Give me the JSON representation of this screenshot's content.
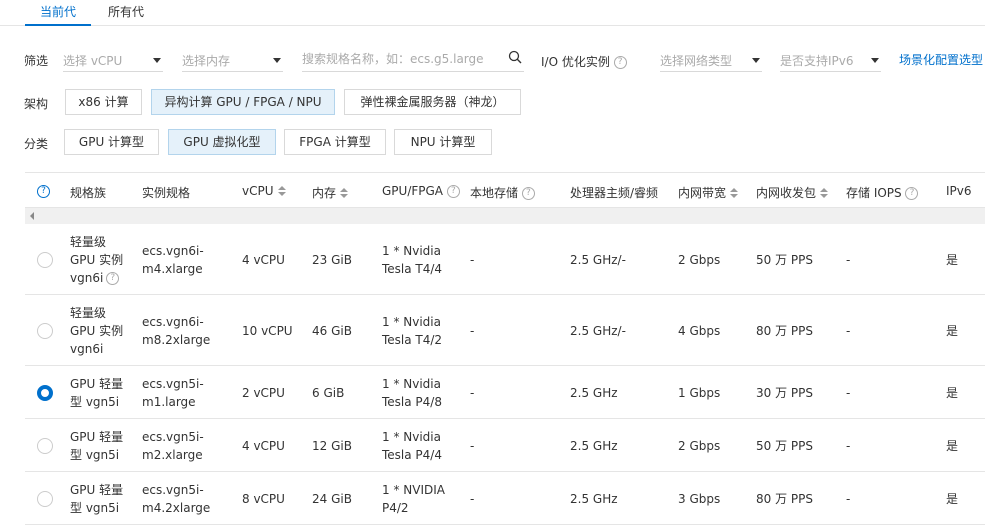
{
  "tabs": [
    {
      "label": "当前代",
      "active": true
    },
    {
      "label": "所有代",
      "active": false
    }
  ],
  "filter": {
    "label": "筛选",
    "vcpu_placeholder": "选择 vCPU",
    "memory_placeholder": "选择内存",
    "search_placeholder": "搜索规格名称，如：ecs.g5.large",
    "io_label": "I/O 优化实例",
    "network_placeholder": "选择网络类型",
    "ipv6_placeholder": "是否支持IPv6",
    "scene_link": "场景化配置选型"
  },
  "arch": {
    "label": "架构",
    "options": [
      "x86 计算",
      "异构计算 GPU / FPGA / NPU",
      "弹性裸金属服务器（神龙）"
    ],
    "selected_index": 1
  },
  "category": {
    "label": "分类",
    "options": [
      "GPU 计算型",
      "GPU 虚拟化型",
      "FPGA 计算型",
      "NPU 计算型"
    ],
    "selected_index": 1
  },
  "table": {
    "columns": [
      "规格族",
      "实例规格",
      "vCPU",
      "内存",
      "GPU/FPGA",
      "本地存储",
      "处理器主频/睿频",
      "内网带宽",
      "内网收发包",
      "存储 IOPS",
      "IPv6"
    ],
    "rows": [
      {
        "family": [
          "轻量级",
          "GPU 实例",
          "vgn6i"
        ],
        "spec": [
          "ecs.vgn6i-",
          "m4.xlarge"
        ],
        "vcpu": "4 vCPU",
        "mem": "23 GiB",
        "gpu": [
          "1 * Nvidia",
          "Tesla T4/4"
        ],
        "disk": "-",
        "freq": "2.5 GHz/-",
        "bw": "2 Gbps",
        "pps": "50 万 PPS",
        "iops": "-",
        "ipv6": "是",
        "selected": false
      },
      {
        "family": [
          "轻量级",
          "GPU 实例",
          "vgn6i"
        ],
        "spec": [
          "ecs.vgn6i-",
          "m8.2xlarge"
        ],
        "vcpu": "10 vCPU",
        "mem": "46 GiB",
        "gpu": [
          "1 * Nvidia",
          "Tesla T4/2"
        ],
        "disk": "-",
        "freq": "2.5 GHz/-",
        "bw": "4 Gbps",
        "pps": "80 万 PPS",
        "iops": "-",
        "ipv6": "是",
        "selected": false
      },
      {
        "family": [
          "GPU 轻量",
          "型 vgn5i"
        ],
        "spec": [
          "ecs.vgn5i-",
          "m1.large"
        ],
        "vcpu": "2 vCPU",
        "mem": "6 GiB",
        "gpu": [
          "1 * Nvidia",
          "Tesla P4/8"
        ],
        "disk": "-",
        "freq": "2.5 GHz",
        "bw": "1 Gbps",
        "pps": "30 万 PPS",
        "iops": "-",
        "ipv6": "是",
        "selected": true
      },
      {
        "family": [
          "GPU 轻量",
          "型 vgn5i"
        ],
        "spec": [
          "ecs.vgn5i-",
          "m2.xlarge"
        ],
        "vcpu": "4 vCPU",
        "mem": "12 GiB",
        "gpu": [
          "1 * Nvidia",
          "Tesla P4/4"
        ],
        "disk": "-",
        "freq": "2.5 GHz",
        "bw": "2 Gbps",
        "pps": "50 万 PPS",
        "iops": "-",
        "ipv6": "是",
        "selected": false
      },
      {
        "family": [
          "GPU 轻量",
          "型 vgn5i"
        ],
        "spec": [
          "ecs.vgn5i-",
          "m4.2xlarge"
        ],
        "vcpu": "8 vCPU",
        "mem": "24 GiB",
        "gpu": [
          "1 * NVIDIA",
          "P4/2"
        ],
        "disk": "-",
        "freq": "2.5 GHz",
        "bw": "3 Gbps",
        "pps": "80 万 PPS",
        "iops": "-",
        "ipv6": "是",
        "selected": false
      }
    ]
  },
  "colors": {
    "accent": "#0070cc",
    "selected_chip_bg": "#e5f1fa"
  }
}
